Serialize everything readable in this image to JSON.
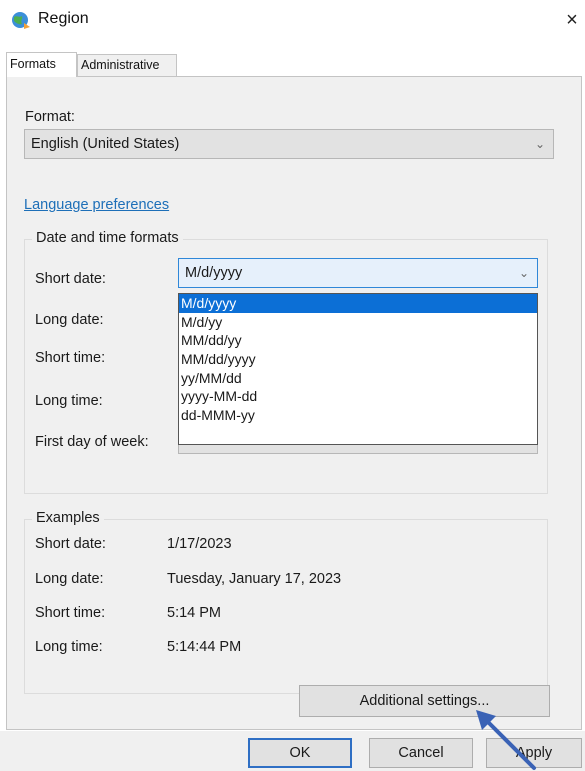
{
  "window": {
    "title": "Region",
    "close_glyph": "×"
  },
  "tabs": [
    {
      "label": "Formats",
      "active": true
    },
    {
      "label": "Administrative",
      "active": false
    }
  ],
  "format": {
    "label": "Format:",
    "value": "English (United States)"
  },
  "language_link": "Language preferences",
  "date_time_formats": {
    "title": "Date and time formats",
    "short_date": {
      "label": "Short date:",
      "value": "M/d/yyyy"
    },
    "long_date": {
      "label": "Long date:"
    },
    "short_time": {
      "label": "Short time:"
    },
    "long_time": {
      "label": "Long time:"
    },
    "first_day": {
      "label": "First day of week:"
    }
  },
  "short_date_options": [
    "M/d/yyyy",
    "M/d/yy",
    "MM/dd/yy",
    "MM/dd/yyyy",
    "yy/MM/dd",
    "yyyy-MM-dd",
    "dd-MMM-yy"
  ],
  "short_date_selected_index": 0,
  "examples": {
    "title": "Examples",
    "rows": [
      {
        "label": "Short date:",
        "value": "1/17/2023"
      },
      {
        "label": "Long date:",
        "value": "Tuesday, January 17, 2023"
      },
      {
        "label": "Short time:",
        "value": "5:14 PM"
      },
      {
        "label": "Long time:",
        "value": "5:14:44 PM"
      }
    ]
  },
  "buttons": {
    "additional_settings": "Additional settings...",
    "ok": "OK",
    "cancel": "Cancel",
    "apply": "Apply"
  },
  "icons": {
    "window_icon": "globe-region-icon",
    "chevron": "chevron-down-icon",
    "annotation": "arrow-pointer-icon"
  },
  "colors": {
    "accent": "#0c6fd6",
    "link": "#1d6fb8",
    "annotation_arrow": "#3a62b5"
  }
}
